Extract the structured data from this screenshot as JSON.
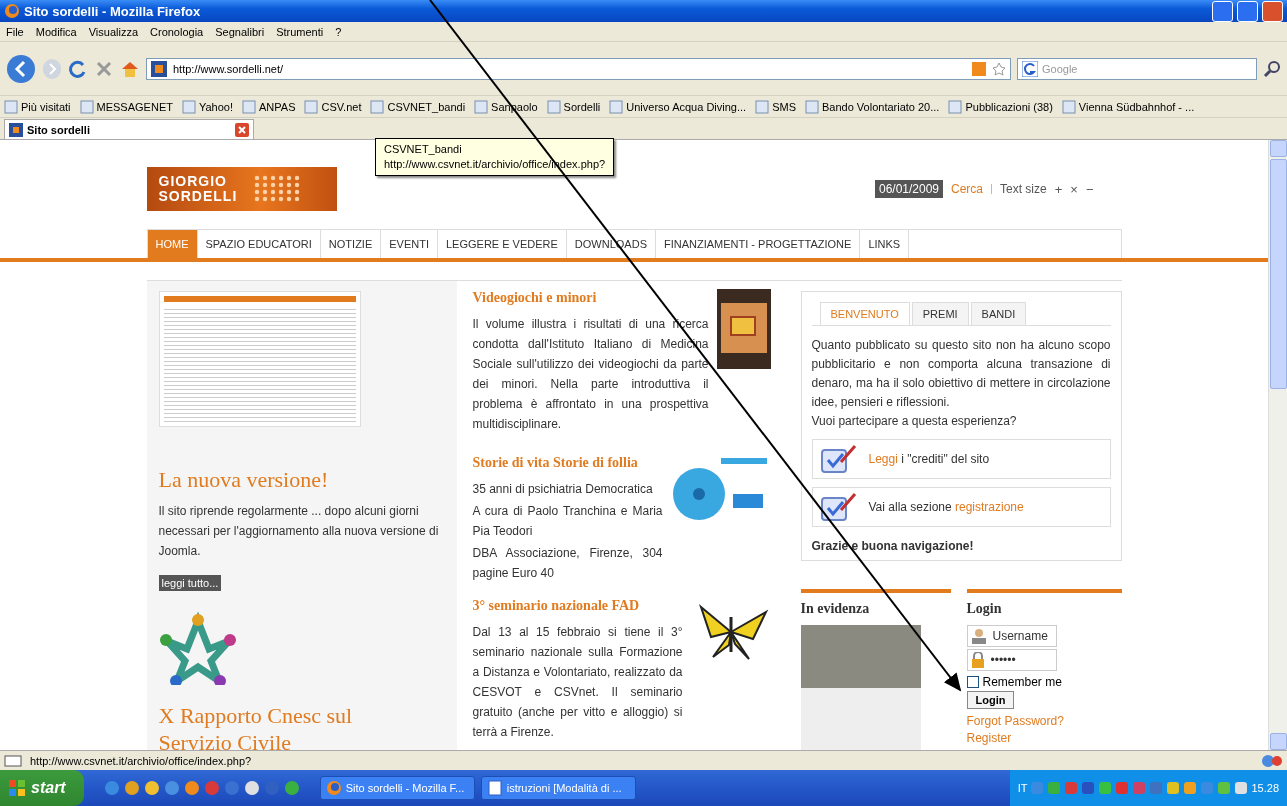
{
  "window": {
    "title": "Sito sordelli - Mozilla Firefox"
  },
  "menu": [
    "File",
    "Modifica",
    "Visualizza",
    "Cronologia",
    "Segnalibri",
    "Strumenti",
    "?"
  ],
  "toolbar": {
    "url": "http://www.sordelli.net/",
    "search_placeholder": "Google"
  },
  "bookmarks": [
    "Più visitati",
    "MESSAGENET",
    "Yahoo!",
    "ANPAS",
    "CSV.net",
    "CSVNET_bandi",
    "Sanpaolo",
    "Sordelli",
    "Universo Acqua Diving...",
    "SMS",
    "Bando Volontariato 20...",
    "Pubblicazioni (38)",
    "Vienna Südbahnhof - ..."
  ],
  "tabs": [
    {
      "label": "Sito sordelli",
      "selected": true
    }
  ],
  "tooltip": {
    "title": "CSVNET_bandi",
    "url": "http://www.csvnet.it/archivio/office/index.php?"
  },
  "page": {
    "logo": [
      "GIORGIO",
      "SORDELLI"
    ],
    "date": "06/01/2009",
    "search": "Cerca",
    "text_size": "Text size",
    "size_controls": [
      "+",
      "×",
      "−"
    ],
    "nav": [
      {
        "label": "HOME",
        "selected": true
      },
      {
        "label": "SPAZIO EDUCATORI",
        "selected": false
      },
      {
        "label": "NOTIZIE",
        "selected": false
      },
      {
        "label": "EVENTI",
        "selected": false
      },
      {
        "label": "LEGGERE E VEDERE",
        "selected": false
      },
      {
        "label": "DOWNLOADS",
        "selected": false
      },
      {
        "label": "FINANZIAMENTI - PROGETTAZIONE",
        "selected": false
      },
      {
        "label": "LINKS",
        "selected": false
      }
    ],
    "left": {
      "headline": "La nuova versione!",
      "text": "Il sito riprende regolarmente ... dopo alcuni giorni necessari per l'aggiornamento alla nuova versione di Joomla.",
      "button": "leggi tutto...",
      "headline_2": "X Rapporto Cnesc sul Servizio Civile"
    },
    "articles": [
      {
        "title": "Videogiochi e minori",
        "paragraphs": [
          " Il volume illustra i risultati di una ricerca condotta dall'Istituto Italiano di Medicina Sociale sull'utilizzo dei videogiochi da parte dei minori. Nella parte introduttiva il problema è affrontato in una prospettiva multidisciplinare."
        ]
      },
      {
        "title": "Storie di vita Storie di follia",
        "paragraphs": [
          "35 anni di psichiatria Democratica",
          "A cura di Paolo Tranchina e Maria Pia Teodori",
          "DBA Associazione, Firenze, 304 pagine Euro 40"
        ]
      },
      {
        "title": "3° seminario nazionale FAD",
        "paragraphs": [
          "Dal 13 al 15 febbraio si tiene il 3° seminario nazionale sulla Formazione a Distanza e Volontariato, realizzato da CESVOT e CSVnet. Il seminario gratuito (anche per vitto e alloggio) si terrà a Firenze."
        ]
      }
    ],
    "panel": {
      "tabs": [
        {
          "label": "BENVENUTO",
          "selected": true
        },
        {
          "label": "PREMI",
          "selected": false
        },
        {
          "label": "BANDI",
          "selected": false
        }
      ],
      "text": "Quanto pubblicato su questo sito non ha alcuno scopo pubblicitario e non comporta alcuna transazione di denaro, ma ha il solo obiettivo di mettere in circolazione idee, pensieri e riflessioni.",
      "question": "Vuoi partecipare a questa esperienza?",
      "links": [
        [
          {
            "text": "Leggi",
            "link": true
          },
          {
            "text": " i \"crediti\" del sito",
            "link": false
          }
        ],
        [
          {
            "text": "Vai alla sezione ",
            "link": false
          },
          {
            "text": "registrazione",
            "link": true
          }
        ]
      ],
      "closing": "Grazie e buona navigazione!"
    },
    "evidenza": {
      "title": "In evidenza"
    },
    "login": {
      "title": "Login",
      "username": "Username",
      "password": "••••••",
      "remember": "Remember me",
      "remember_checked": false,
      "button": "Login",
      "links": [
        "Forgot Password?",
        "Register"
      ]
    }
  },
  "status_bar": "http://www.csvnet.it/archivio/office/index.php?",
  "taskbar": {
    "start": "start",
    "tasks": [
      "Sito sordelli - Mozilla F...",
      "istruzioni [Modalità di ..."
    ],
    "language": "IT",
    "clock": "15.28"
  }
}
